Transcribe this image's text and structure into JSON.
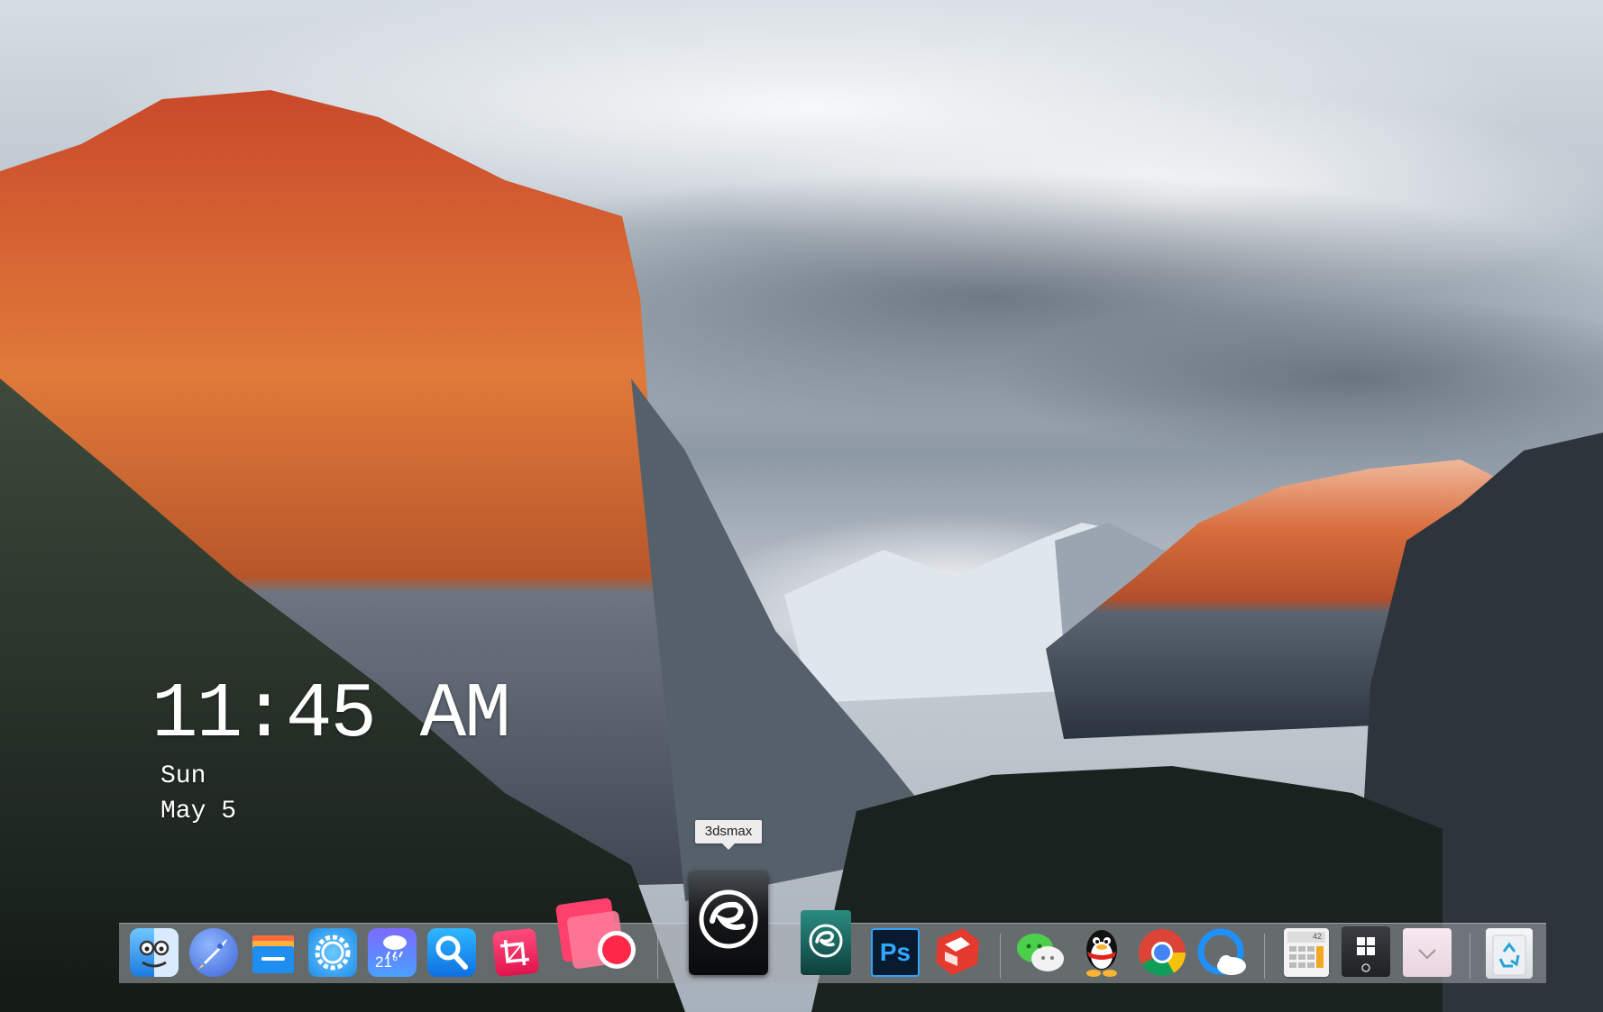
{
  "desktop": {
    "clock": {
      "time": "11:45 AM",
      "day": "Sun",
      "date": "May 5"
    },
    "tooltip": "3dsmax"
  },
  "dock": {
    "items": [
      {
        "id": "finder",
        "icon": "finder-icon"
      },
      {
        "id": "launchpad",
        "icon": "rocket-icon"
      },
      {
        "id": "files",
        "icon": "folder-icon"
      },
      {
        "id": "settings",
        "icon": "gear-icon"
      },
      {
        "id": "weather",
        "icon": "weather-icon",
        "temp": "21°"
      },
      {
        "id": "search",
        "icon": "search-icon"
      },
      {
        "id": "crop-tool",
        "icon": "crop-icon"
      },
      {
        "id": "screen-recorder",
        "icon": "record-icon"
      },
      {
        "id": "3dsmax",
        "icon": "3dsmax-icon"
      },
      {
        "id": "3dsmax-alt",
        "icon": "3dsmax-small-icon"
      },
      {
        "id": "photoshop",
        "icon": "ps-icon",
        "label": "Ps"
      },
      {
        "id": "sketchup",
        "icon": "sketchup-icon"
      },
      {
        "id": "wechat",
        "icon": "wechat-icon"
      },
      {
        "id": "qq",
        "icon": "penguin-icon"
      },
      {
        "id": "chrome",
        "icon": "chrome-icon"
      },
      {
        "id": "weather-cloud",
        "icon": "cloud-icon"
      },
      {
        "id": "calculator",
        "icon": "calculator-icon",
        "label": "42"
      },
      {
        "id": "start",
        "icon": "windows-icon"
      },
      {
        "id": "downloads",
        "icon": "download-icon"
      },
      {
        "id": "recycle-bin",
        "icon": "recycle-icon"
      }
    ]
  },
  "colors": {
    "dock_bg": "#a5aaae",
    "tooltip_bg": "#ededed",
    "clock_text": "#ffffff"
  }
}
